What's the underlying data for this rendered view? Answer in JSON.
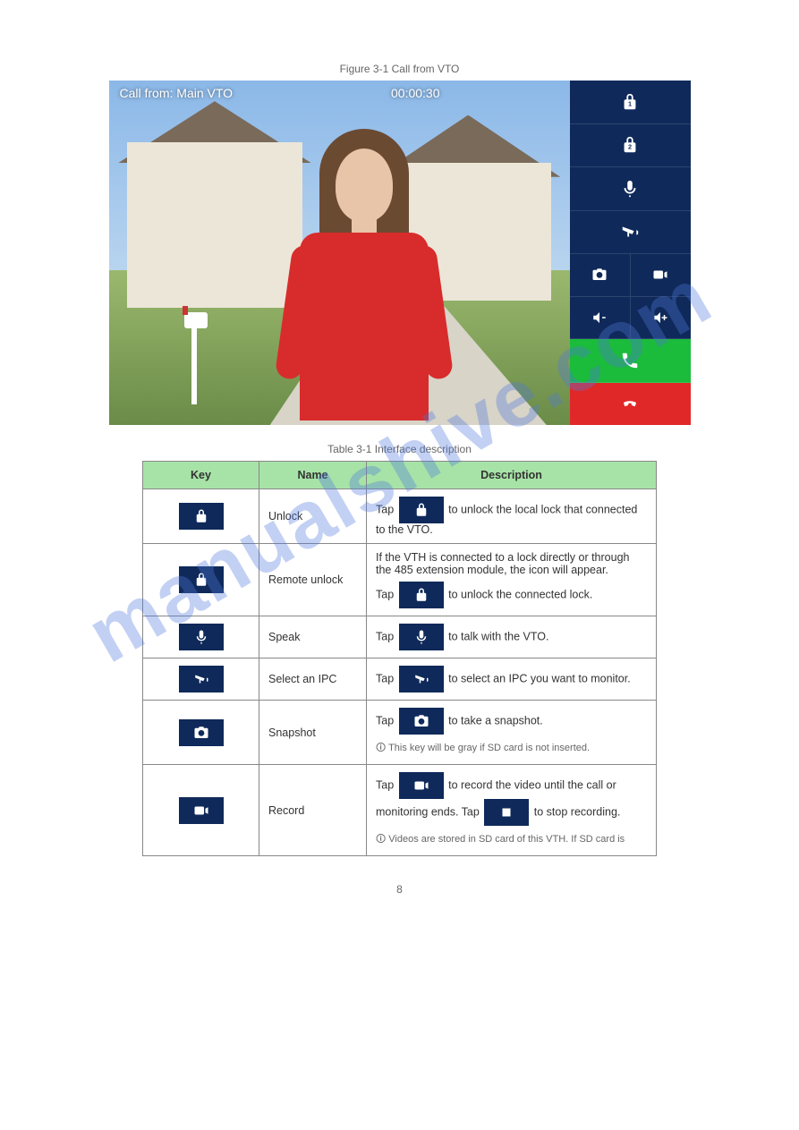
{
  "watermark": "manualshive.com",
  "figure_label": "Figure 3-1 Call from VTO",
  "vth": {
    "call_from": "Call from: Main VTO",
    "timer": "00:00:30",
    "buttons": {
      "unlock1": "Unlock 1",
      "unlock2": "Unlock 2",
      "mic": "Speak",
      "ipc": "Select IPC",
      "snapshot": "Snapshot",
      "record": "Record",
      "vol_down": "Volume down",
      "vol_up": "Volume up",
      "answer": "Answer",
      "hangup": "Hang up"
    }
  },
  "table_label": "Table 3-1 Interface description",
  "table": {
    "headers": [
      "Key",
      "Name",
      "Description"
    ],
    "rows": [
      {
        "name": "Unlock",
        "desc_before": "Tap ",
        "desc_after": " to unlock the local lock that connected to the VTO."
      },
      {
        "name": "Remote unlock",
        "desc_line1": "If the VTH is connected to a lock directly or through the 485 extension module, the icon will appear.",
        "desc_before": "Tap ",
        "desc_after": " to unlock the connected lock."
      },
      {
        "name": "Speak",
        "desc_before": "Tap ",
        "desc_after": " to talk with the VTO."
      },
      {
        "name": "Select an IPC",
        "desc_before": "Tap ",
        "desc_after": " to select an IPC you want to monitor."
      },
      {
        "name": "Snapshot",
        "desc_before": "Tap ",
        "desc_after": " to take a snapshot.",
        "note": "This key will be gray if SD card is not inserted."
      },
      {
        "name": "Record",
        "desc_l1_before": "Tap ",
        "desc_l1_after": " to record the video until the call or monitoring ends. Tap ",
        "desc_l2_after": " to stop recording.",
        "note": "Videos are stored in SD card of this VTH. If SD card is"
      }
    ]
  },
  "page": "8"
}
